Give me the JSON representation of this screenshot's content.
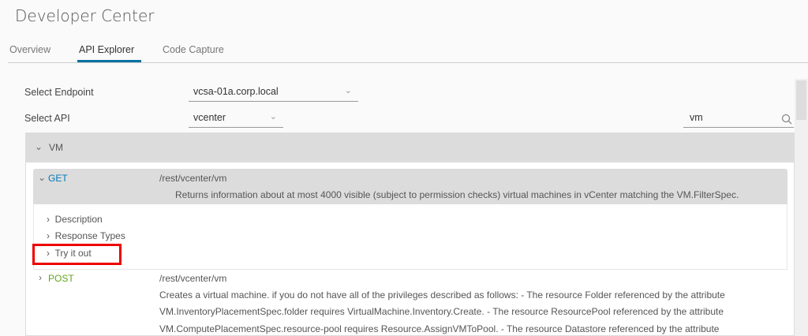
{
  "header": {
    "title": "Developer Center"
  },
  "tabs": [
    {
      "label": "Overview"
    },
    {
      "label": "API Explorer"
    },
    {
      "label": "Code Capture"
    }
  ],
  "form": {
    "endpoint_label": "Select Endpoint",
    "endpoint_value": "vcsa-01a.corp.local",
    "api_label": "Select API",
    "api_value": "vcenter",
    "search_value": "vm"
  },
  "section": {
    "title": "VM"
  },
  "operations": [
    {
      "method": "GET",
      "method_color": "#0079b8",
      "path": "/rest/vcenter/vm",
      "summary": "Returns information about at most 4000 visible (subject to permission checks) virtual machines in vCenter matching the VM.FilterSpec.",
      "subitems": [
        "Description",
        "Response Types",
        "Try it out"
      ]
    },
    {
      "method": "POST",
      "method_color": "#62a420",
      "path": "/rest/vcenter/vm",
      "lines": [
        "Creates a virtual machine. if you do not have all of the privileges described as follows: - The resource Folder referenced by the attribute",
        "VM.InventoryPlacementSpec.folder requires VirtualMachine.Inventory.Create. - The resource ResourcePool referenced by the attribute",
        "VM.ComputePlacementSpec.resource-pool requires Resource.AssignVMToPool. - The resource Datastore referenced by the attribute"
      ]
    }
  ]
}
